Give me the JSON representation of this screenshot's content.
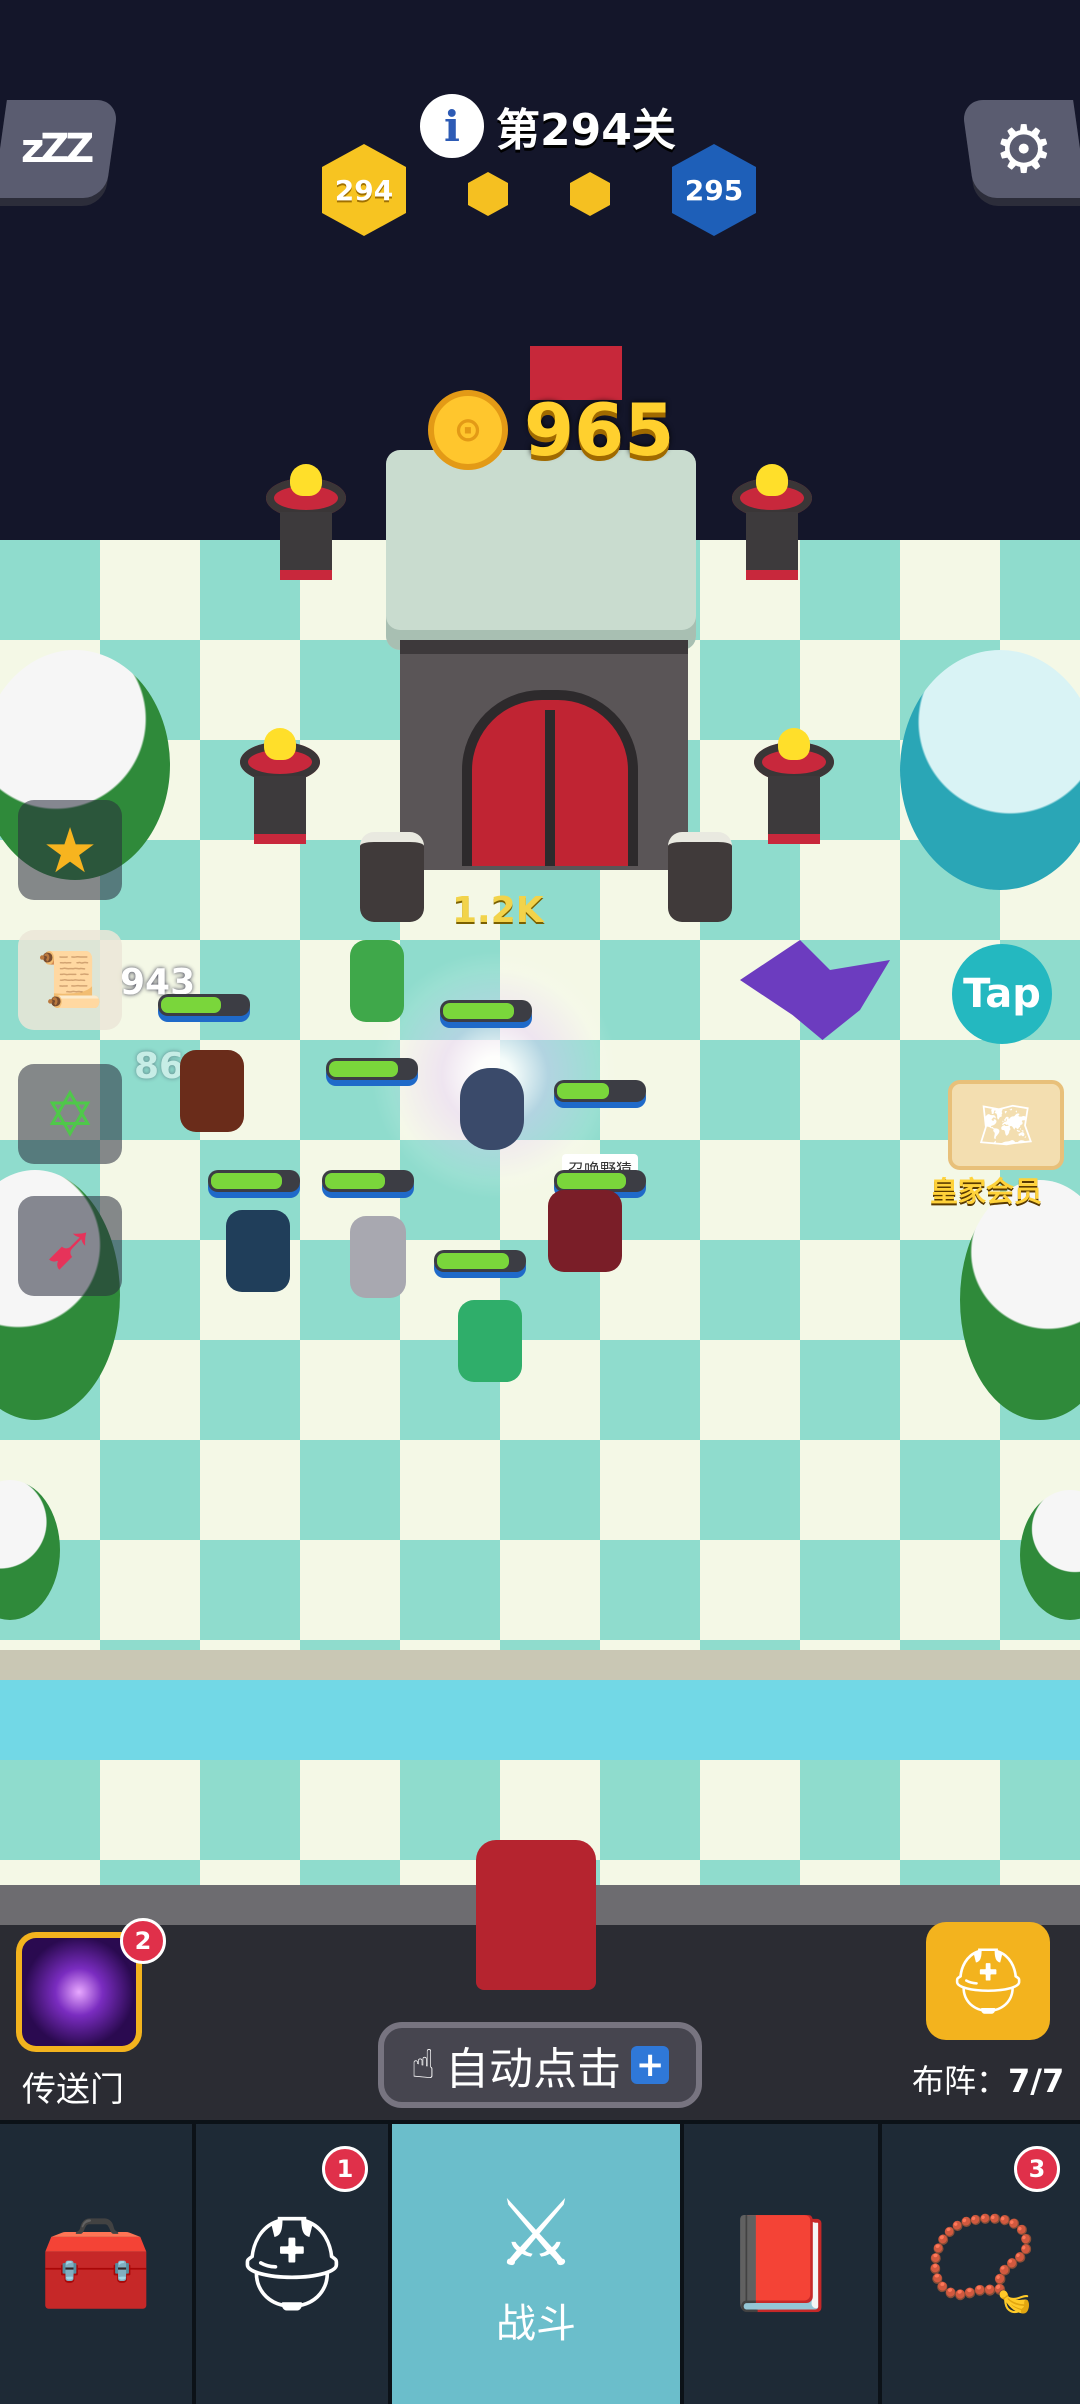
{
  "header": {
    "level_label": "第294关",
    "current_level": "294",
    "next_level": "295",
    "sleep_icon_text": "zZZ",
    "info_icon_text": "i"
  },
  "castle": {
    "coin_icon_text": "⊙",
    "coins": "965"
  },
  "battle": {
    "floating_numbers": [
      "1.2K",
      "943",
      "86"
    ],
    "hero_tag": "召唤野猿"
  },
  "right_side": {
    "tap_label": "Tap",
    "royal_member_label": "皇家会员"
  },
  "bottom": {
    "portal_label": "传送门",
    "portal_badge": "2",
    "auto_click_label": "自动点击",
    "auto_click_plus": "+",
    "formation_label": "布阵：",
    "formation_value": "7/7"
  },
  "tabs": [
    {
      "name": "treasure",
      "label": "",
      "badge": ""
    },
    {
      "name": "heroes",
      "label": "",
      "badge": "1"
    },
    {
      "name": "battle",
      "label": "战斗",
      "badge": ""
    },
    {
      "name": "spellbook",
      "label": "",
      "badge": ""
    },
    {
      "name": "amulet",
      "label": "",
      "badge": "3"
    }
  ],
  "colors": {
    "board_light": "#f4f8e6",
    "board_dark": "#8fdccd",
    "accent_gold": "#f7c421",
    "accent_blue": "#1e5fb8",
    "tab_active": "#6bbecb"
  }
}
